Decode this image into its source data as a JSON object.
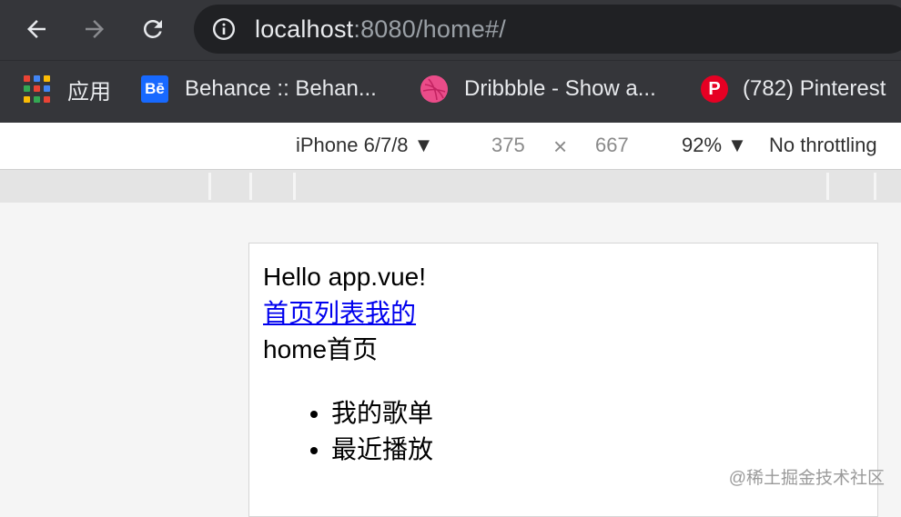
{
  "browser": {
    "url_host": "localhost",
    "url_rest": ":8080/home#/",
    "bookmarks": [
      {
        "label": "应用",
        "icon": "apps-grid-icon"
      },
      {
        "label": "Behance :: Behan...",
        "icon": "behance-icon",
        "icon_text": "Bē"
      },
      {
        "label": "Dribbble - Show a...",
        "icon": "dribbble-icon"
      },
      {
        "label": "(782) Pinterest",
        "icon": "pinterest-icon",
        "icon_text": "P"
      }
    ]
  },
  "devtools": {
    "device": "iPhone 6/7/8 ▼",
    "width": "375",
    "times": "×",
    "height": "667",
    "zoom": "92% ▼",
    "throttling": "No throttling"
  },
  "page": {
    "title": "Hello app.vue!",
    "nav_links": [
      "首页",
      "列表",
      "我的"
    ],
    "heading": "home首页",
    "songs": [
      "我的歌单",
      "最近播放"
    ]
  },
  "watermark": "@稀土掘金技术社区",
  "colors": {
    "chrome_bg": "#35363a",
    "omnibox_bg": "#202124",
    "link": "#0000ee"
  }
}
